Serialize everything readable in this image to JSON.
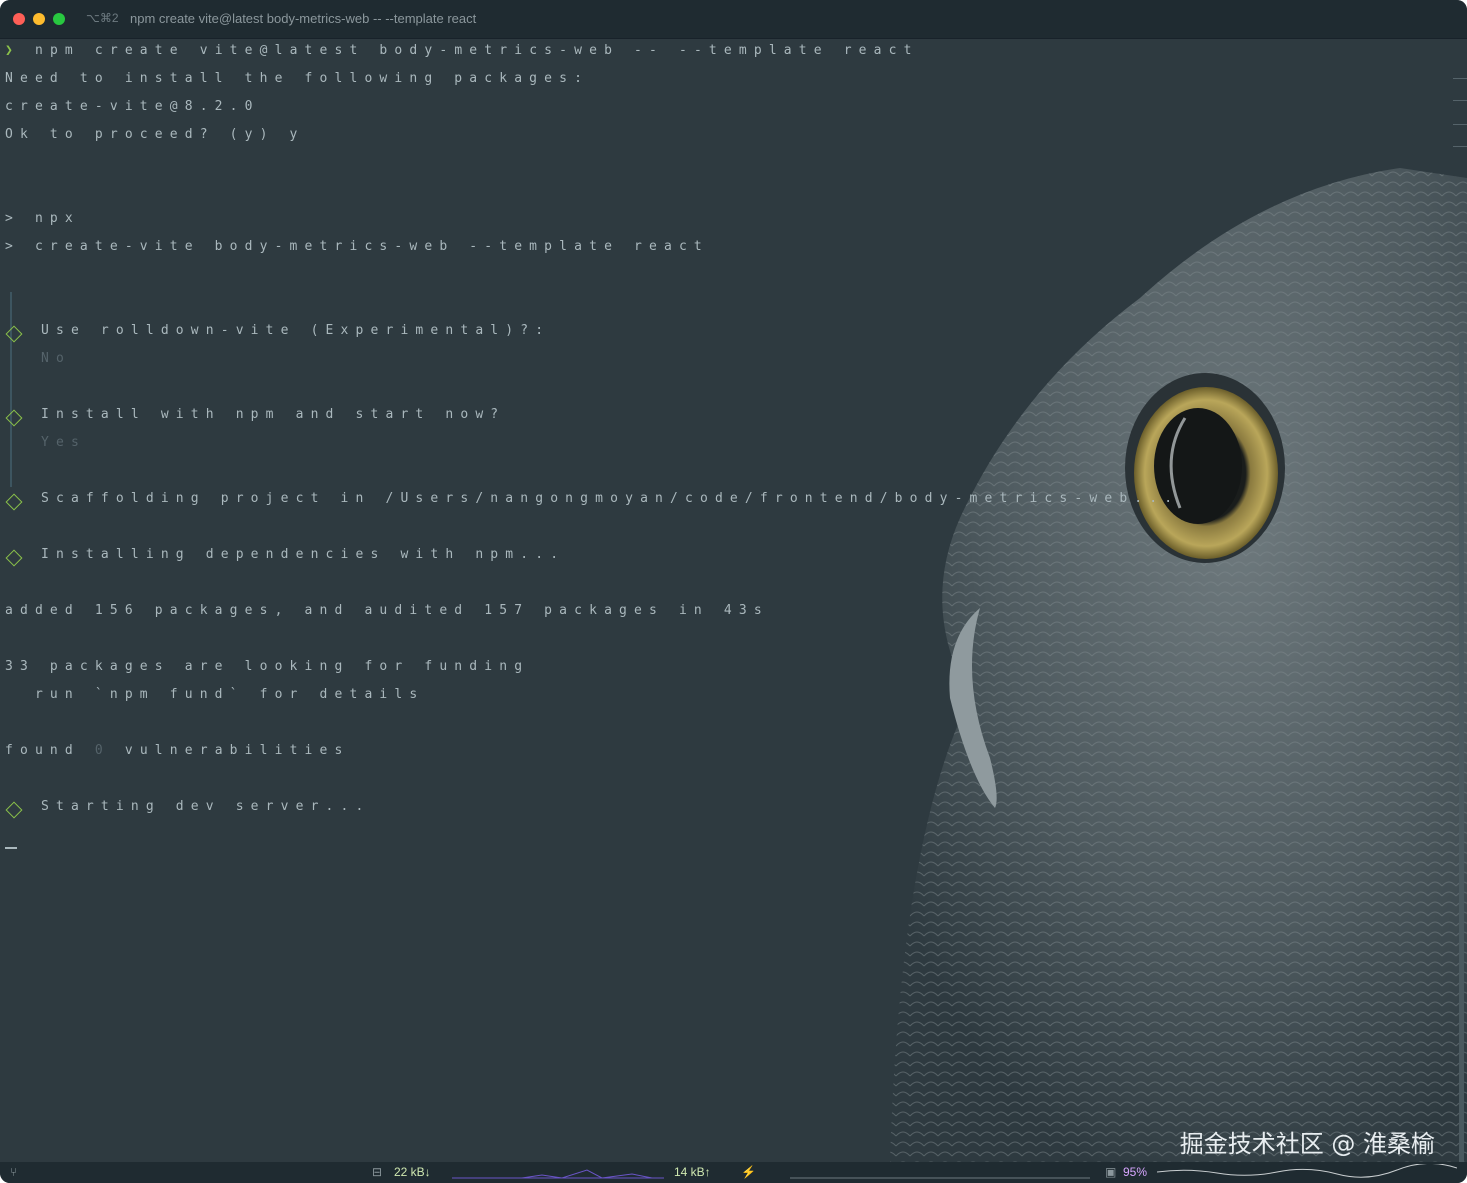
{
  "window": {
    "shortcut": "⌥⌘2",
    "title": "npm create vite@latest body-metrics-web -- --template react"
  },
  "terminal": {
    "prompt_symbol": "❯",
    "command": "npm create vite@latest body-metrics-web -- --template react",
    "need_install": "Need to install the following packages:",
    "package": "create-vite@8.2.0",
    "proceed": "Ok to proceed? (y) y",
    "npx": "> npx",
    "create_vite": "> create-vite body-metrics-web --template react",
    "q_rolldown": "Use rolldown-vite (Experimental)?:",
    "a_rolldown": "No",
    "q_install": "Install with npm and start now?",
    "a_install": "Yes",
    "scaffolding": "Scaffolding project in /Users/nangongmoyan/code/frontend/body-metrics-web...",
    "installing": "Installing dependencies with npm...",
    "added": "added 156 packages, and audited 157 packages in 43s",
    "funding": "33 packages are looking for funding",
    "funding_hint": "  run `npm fund` for details",
    "found_prefix": "found ",
    "found_zero": "0",
    "found_suffix": " vulnerabilities",
    "starting": "Starting dev server..."
  },
  "watermark": "掘金技术社区 @ 淮桑榆",
  "statusbar": {
    "branch_icon": "git-branch-icon",
    "network_down": "22 kB↓",
    "network_up": "14 kB↑",
    "power_icon": "plug-icon",
    "cpu": "95%"
  },
  "colors": {
    "background": "#2e3a40",
    "text": "#aab8bd",
    "accent_green": "#8bc34a",
    "traffic_close": "#fe5f57",
    "traffic_min": "#febc2e",
    "traffic_max": "#28c840"
  }
}
